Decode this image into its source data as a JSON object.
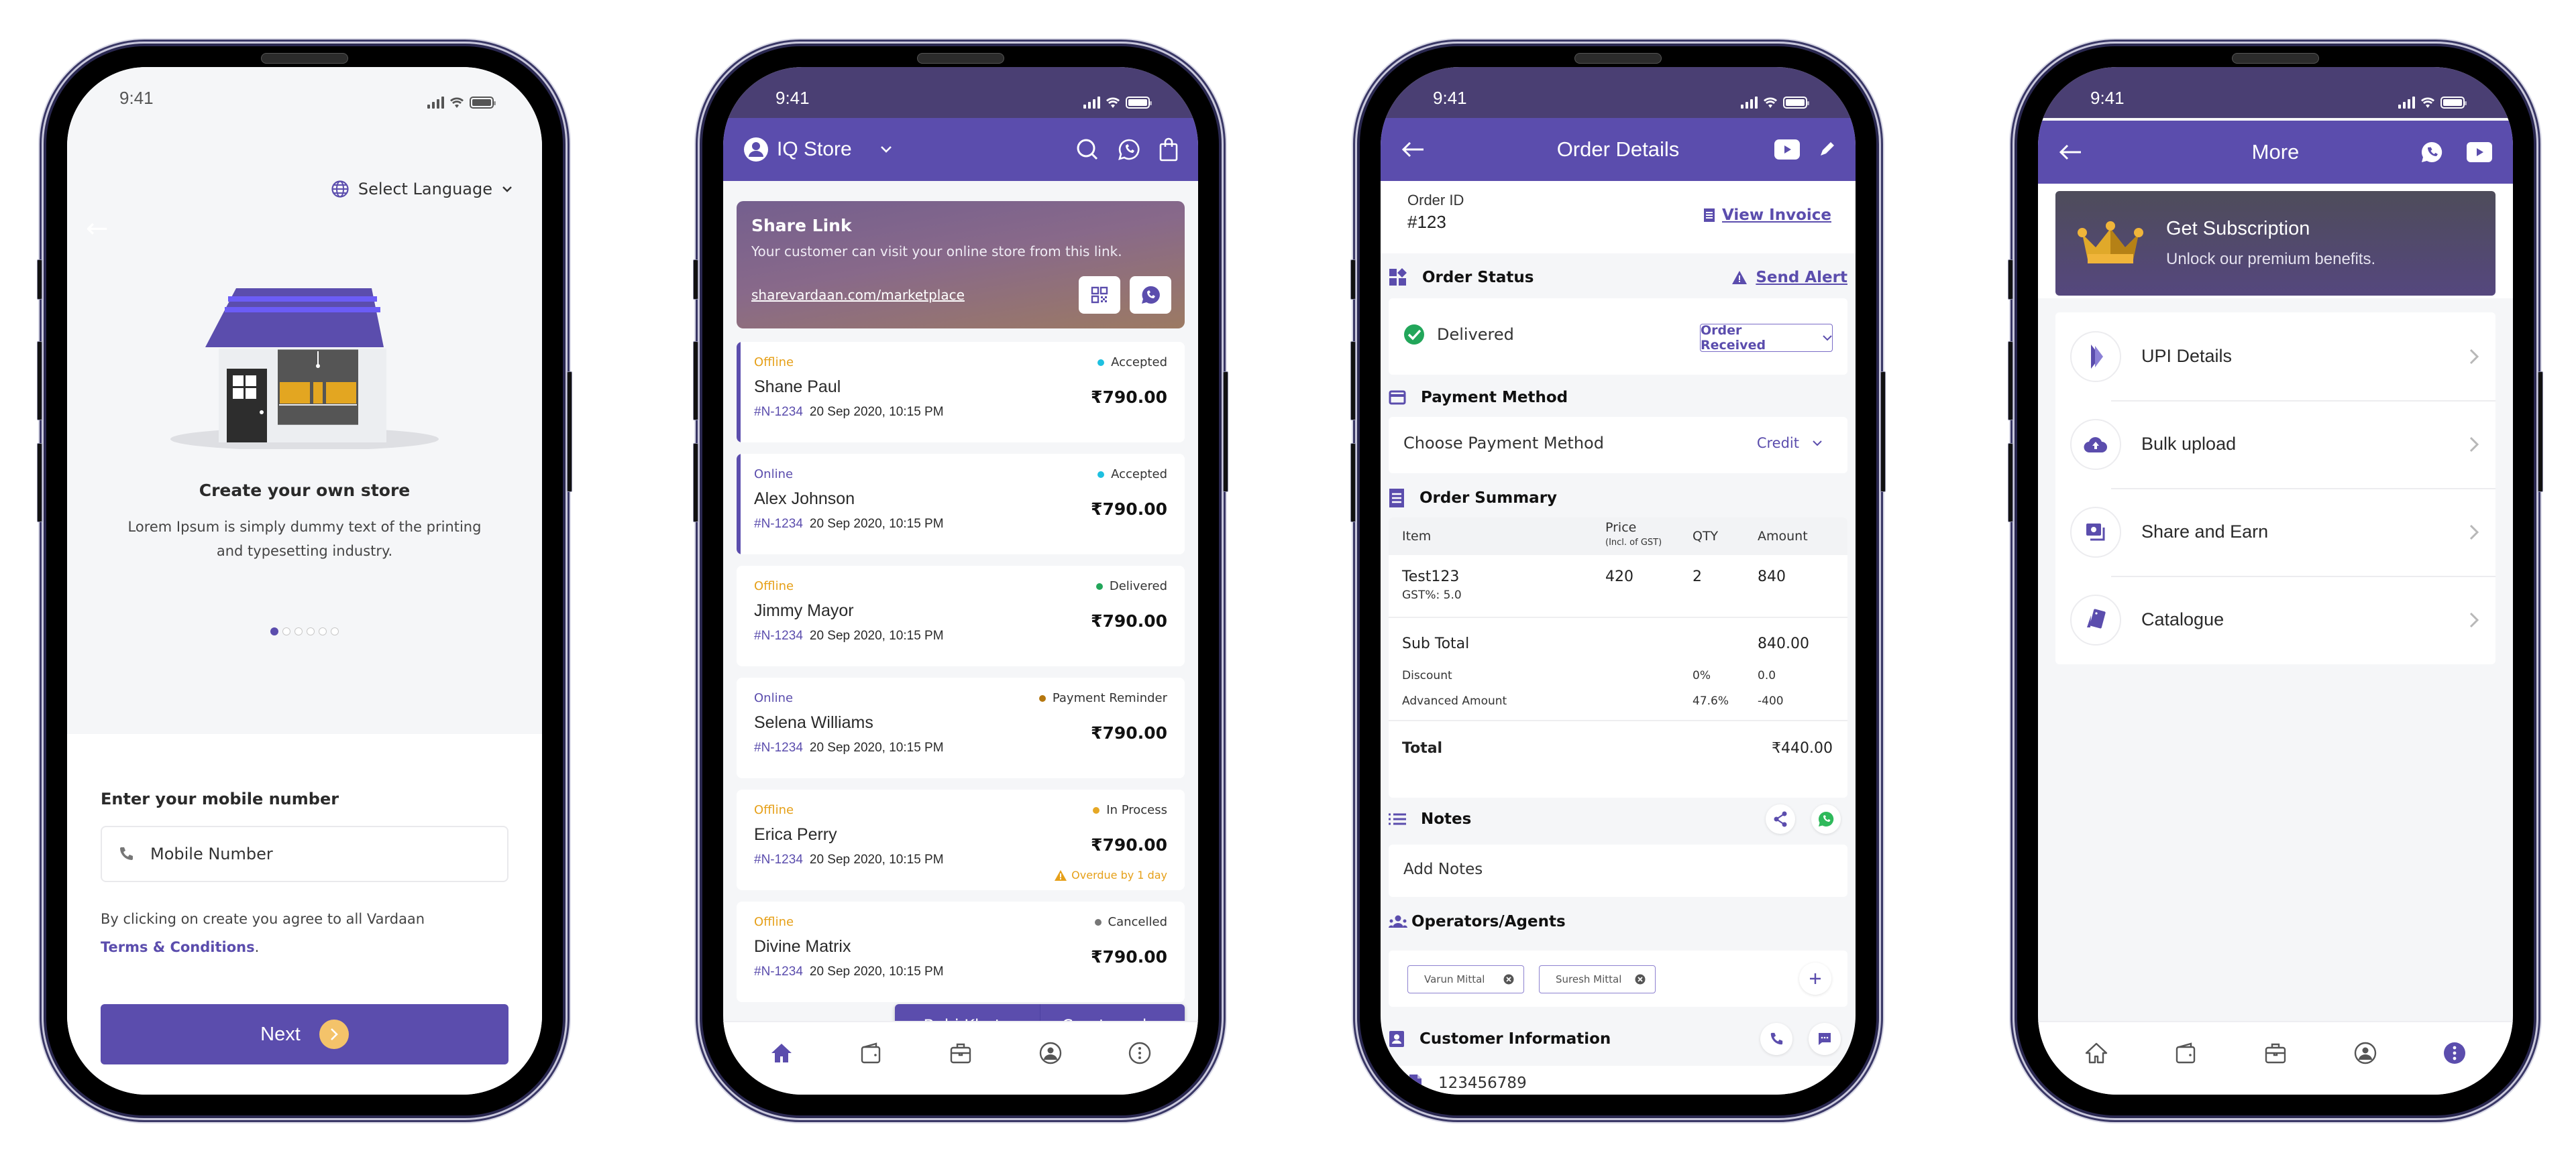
{
  "status_bar": {
    "time": "9:41"
  },
  "colors": {
    "primary": "#5b4dad",
    "status_bar_dark": "#4a3f73",
    "offline": "#e6a019",
    "online": "#5b4dad",
    "accepted": "#1ec0e0",
    "delivered": "#22a65a",
    "payment_reminder": "#b5770f",
    "in_process": "#e6a825",
    "cancelled": "#777777",
    "next_arrow": "#f4c36a"
  },
  "screen1": {
    "language_selector": "Select Language",
    "heading": "Create your own store",
    "description": "Lorem Ipsum is simply dummy text of the printing and typesetting industry.",
    "carousel": {
      "total": 6,
      "active": 1
    },
    "mobile_label": "Enter your mobile number",
    "mobile_placeholder": "Mobile Number",
    "terms_prefix": "By clicking on create you agree to all Vardaan",
    "terms_link": "Terms & Conditions",
    "terms_suffix": ".",
    "next_button": "Next"
  },
  "screen2": {
    "store_name": "IQ Store",
    "share": {
      "title": "Share Link",
      "description": "Your customer can visit your online store from this link.",
      "link": "sharevardaan.com/marketplace"
    },
    "orders": [
      {
        "channel": "Offline",
        "status": "Accepted",
        "status_key": "accepted",
        "name": "Shane Paul",
        "id": "#N-1234",
        "datetime": "20 Sep 2020, 10:15 PM",
        "amount": "₹790.00",
        "marked": true
      },
      {
        "channel": "Online",
        "status": "Accepted",
        "status_key": "accepted",
        "name": "Alex Johnson",
        "id": "#N-1234",
        "datetime": "20 Sep 2020, 10:15 PM",
        "amount": "₹790.00",
        "marked": true
      },
      {
        "channel": "Offline",
        "status": "Delivered",
        "status_key": "delivered",
        "name": "Jimmy Mayor",
        "id": "#N-1234",
        "datetime": "20 Sep 2020, 10:15 PM",
        "amount": "₹790.00",
        "marked": false
      },
      {
        "channel": "Online",
        "status": "Payment Reminder",
        "status_key": "payment_reminder",
        "name": "Selena Williams",
        "id": "#N-1234",
        "datetime": "20 Sep 2020, 10:15 PM",
        "amount": "₹790.00",
        "marked": false
      },
      {
        "channel": "Offline",
        "status": "In Process",
        "status_key": "in_process",
        "name": "Erica Perry",
        "id": "#N-1234",
        "datetime": "20 Sep 2020, 10:15 PM",
        "amount": "₹790.00",
        "marked": false,
        "overdue": "Overdue by 1 day"
      },
      {
        "channel": "Offline",
        "status": "Cancelled",
        "status_key": "cancelled",
        "name": "Divine Matrix",
        "id": "#N-1234",
        "datetime": "20 Sep 2020, 10:15 PM",
        "amount": "₹790.00",
        "marked": false
      }
    ],
    "fab": {
      "left": "Bahi Khata",
      "right": "Create order"
    },
    "nav": {
      "active": "home"
    }
  },
  "screen3": {
    "title": "Order Details",
    "order_id_label": "Order ID",
    "order_id": "#123",
    "view_invoice": "View Invoice",
    "order_status_title": "Order Status",
    "send_alert": "Send Alert",
    "current_status": "Delivered",
    "status_dropdown": "Order Received",
    "payment_title": "Payment Method",
    "payment_label": "Choose Payment Method",
    "payment_value": "Credit",
    "summary_title": "Order Summary",
    "table_headers": {
      "item": "Item",
      "price": "Price",
      "price_note": "(Incl. of GST)",
      "qty": "QTY",
      "amount": "Amount"
    },
    "items": [
      {
        "name": "Test123",
        "gst": "GST%: 5.0",
        "price": "420",
        "qty": "2",
        "amount": "840"
      }
    ],
    "subtotal_label": "Sub Total",
    "subtotal": "840.00",
    "discount_label": "Discount",
    "discount_pct": "0%",
    "discount": "0.0",
    "advance_label": "Advanced Amount",
    "advance_pct": "47.6%",
    "advance": "-400",
    "total_label": "Total",
    "total": "₹440.00",
    "notes_title": "Notes",
    "notes_placeholder": "Add Notes",
    "operators_title": "Operators/Agents",
    "operators": [
      "Varun Mittal",
      "Suresh Mittal"
    ],
    "customer_title": "Customer Information",
    "gst_number": "123456789"
  },
  "screen4": {
    "title": "More",
    "subscription_title": "Get Subscription",
    "subscription_subtitle": "Unlock our premium benefits.",
    "menu": [
      {
        "label": "UPI Details",
        "icon": "upi-icon"
      },
      {
        "label": "Bulk upload",
        "icon": "cloud-upload-icon"
      },
      {
        "label": "Share and Earn",
        "icon": "share-earn-icon"
      },
      {
        "label": "Catalogue",
        "icon": "catalogue-icon"
      }
    ],
    "nav": {
      "active": "more"
    }
  }
}
